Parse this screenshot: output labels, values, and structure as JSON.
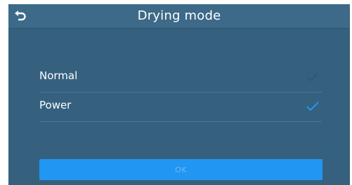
{
  "header": {
    "title": "Drying mode",
    "back_icon": "back-arrow-icon"
  },
  "options": [
    {
      "label": "Normal",
      "selected": false,
      "check_color": "#2c5a76"
    },
    {
      "label": "Power",
      "selected": true,
      "check_color": "#2196f3"
    }
  ],
  "ok_button": {
    "label": "OK",
    "color": "#2196f3"
  },
  "colors": {
    "background": "#35617f",
    "header": "#3c6a88",
    "accent": "#2196f3"
  }
}
